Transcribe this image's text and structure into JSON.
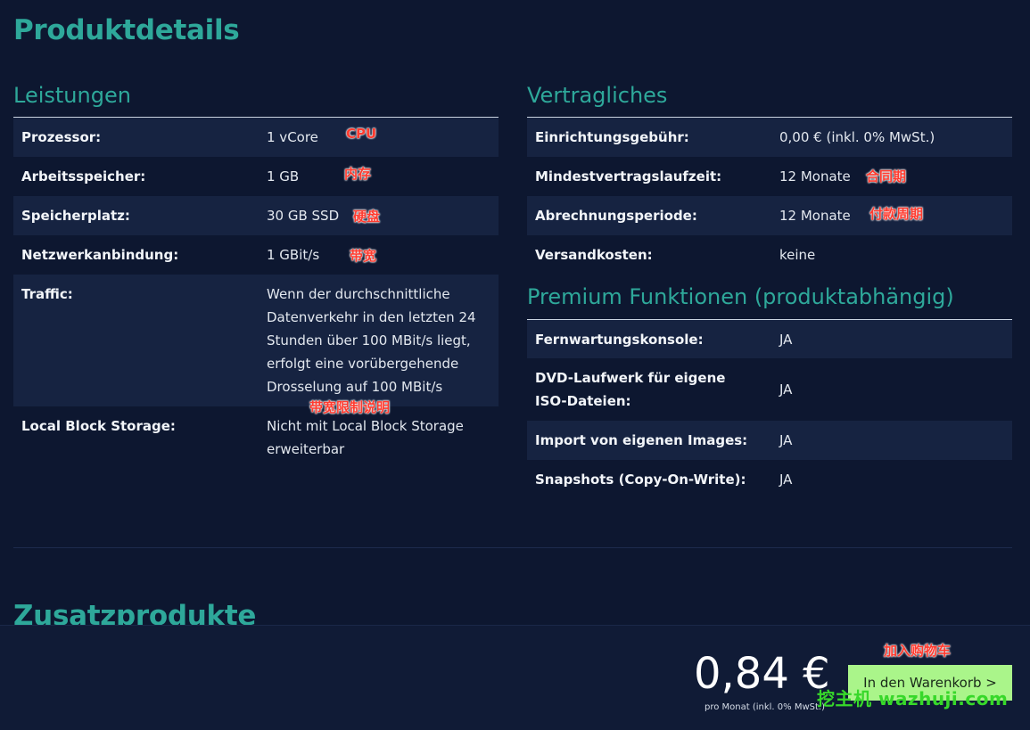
{
  "page_title": "Produktdetails",
  "leistungen": {
    "title": "Leistungen",
    "rows": [
      {
        "key": "Prozessor:",
        "value": "1 vCore"
      },
      {
        "key": "Arbeitsspeicher:",
        "value": "1 GB"
      },
      {
        "key": "Speicherplatz:",
        "value": "30 GB SSD"
      },
      {
        "key": "Netzwerkanbindung:",
        "value": "1 GBit/s"
      },
      {
        "key": "Traffic:",
        "value": "Wenn der durchschnittliche Datenverkehr in den letzten 24 Stunden über 100 MBit/s liegt, erfolgt eine vorübergehende Drosselung auf 100 MBit/s"
      },
      {
        "key": "Local Block Storage:",
        "value": "Nicht mit Local Block Storage erweiterbar"
      }
    ]
  },
  "vertragliches": {
    "title": "Vertragliches",
    "rows": [
      {
        "key": "Einrichtungsgebühr:",
        "value": "0,00 € (inkl. 0% MwSt.)"
      },
      {
        "key": "Mindestvertragslaufzeit:",
        "value": "12 Monate"
      },
      {
        "key": "Abrechnungsperiode:",
        "value": "12 Monate"
      },
      {
        "key": "Versandkosten:",
        "value": "keine"
      }
    ]
  },
  "premium": {
    "title": "Premium Funktionen (produktabhängig)",
    "rows": [
      {
        "key": "Fernwartungskonsole:",
        "value": "JA"
      },
      {
        "key": "DVD-Laufwerk für eigene ISO-Dateien:",
        "value": "JA"
      },
      {
        "key": "Import von eigenen Images:",
        "value": "JA"
      },
      {
        "key": "Snapshots (Copy-On-Write):",
        "value": "JA"
      }
    ]
  },
  "annotations": {
    "cpu": "CPU",
    "ram": "内存",
    "disk": "硬盘",
    "bandwidth": "带宽",
    "traffic": "带宽限制说明",
    "contract": "合同期",
    "billing": "付款周期",
    "cart": "加入购物车"
  },
  "addon_title": "Zusatzprodukte",
  "cart": {
    "price": "0,84 €",
    "price_note": "pro Monat (inkl. 0% MwSt.)",
    "button_label": "In den Warenkorb >"
  },
  "watermark": "挖主机 wazhuji.com",
  "colors": {
    "background": "#0d1730",
    "accent": "#2ea89a",
    "row_shade": "#162341",
    "button": "#aaf58a",
    "annotation": "#ff3b2f",
    "watermark": "#37d82a"
  }
}
